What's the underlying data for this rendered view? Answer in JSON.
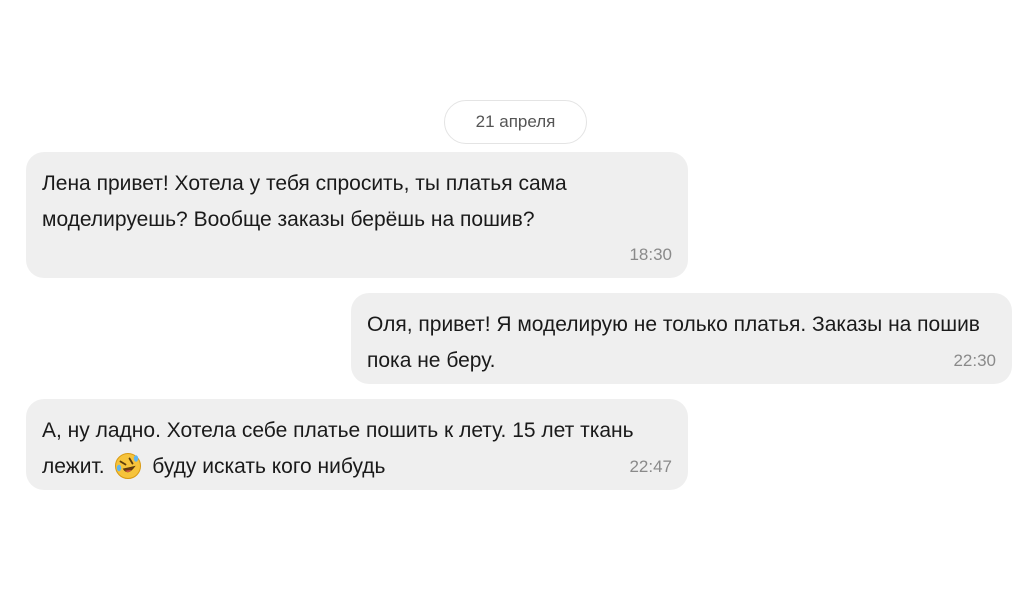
{
  "date_separator": "21 апреля",
  "messages": [
    {
      "side": "incoming",
      "text": "Лена привет! Хотела у тебя спросить, ты платья сама моделируешь? Вообще заказы берёшь на пошив?",
      "time": "18:30"
    },
    {
      "side": "outgoing",
      "text": "Оля, привет! Я моделирую не только платья. Заказы на пошив пока не беру.",
      "time": "22:30"
    },
    {
      "side": "incoming",
      "text_before_emoji": "А, ну ладно. Хотела себе платье пошить к лету. 15 лет ткань лежит.",
      "emoji": "rolling-on-floor-laughing-icon",
      "text_after_emoji": "буду искать кого нибудь",
      "time": "22:47"
    }
  ],
  "colors": {
    "bubble_background": "#efefef",
    "time_text": "#8a8a8a",
    "date_pill_border": "#e4e4e4"
  }
}
